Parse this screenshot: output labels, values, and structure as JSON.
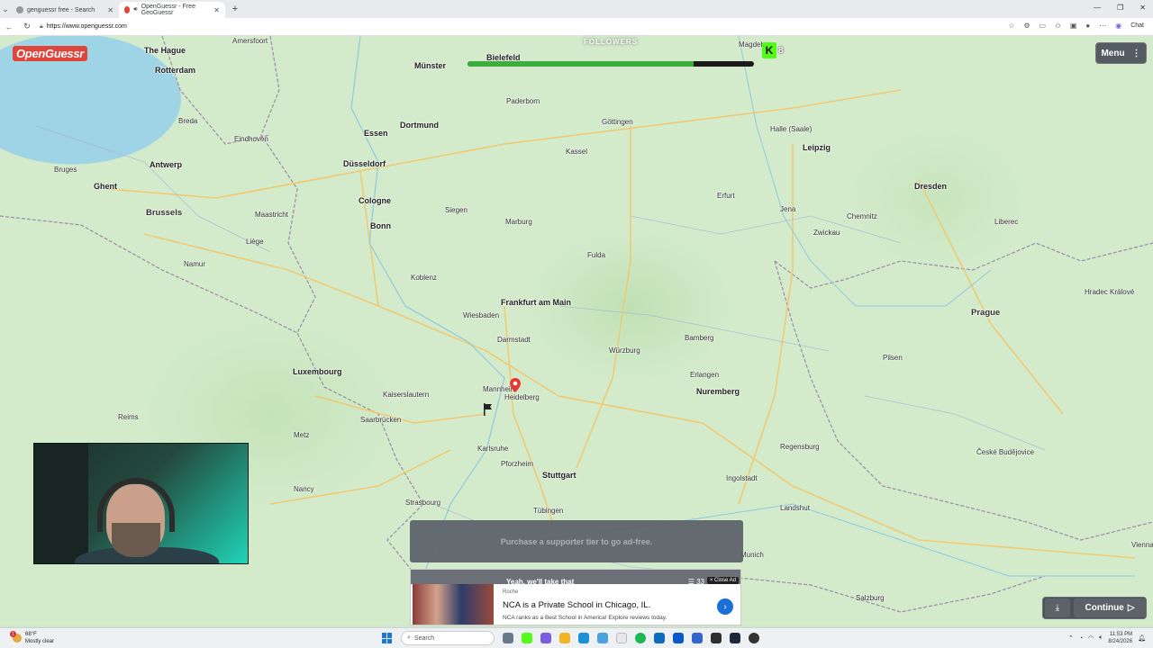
{
  "browser": {
    "tabs": [
      {
        "label": "genguessr free - Search",
        "active": false
      },
      {
        "label": "OpenGuessr - Free GeoGuessr",
        "active": true
      }
    ],
    "new_tab": "+",
    "url": "https://www.openguessr.com",
    "chat_label": "Chat",
    "window_controls": [
      "—",
      "❐",
      "✕"
    ]
  },
  "game": {
    "logo": "OpenGuessr",
    "menu_label": "Menu",
    "followers_label": "FOLLOWERS",
    "followers_progress": 0.79,
    "kick_count": "8",
    "continue_label": "Continue",
    "adfree_text": "Purchase a supporter tier to go ad-free."
  },
  "ad": {
    "header_text": "Yeah, we'll take that",
    "count": "33",
    "close_label": "× Close Ad",
    "sponsor": "Roche",
    "title": "NCA is a Private School in Chicago, IL.",
    "description": "NCA ranks as a Best School in America! Explore reviews today."
  },
  "map": {
    "cities": [
      {
        "name": "The Hague",
        "cls": "big"
      },
      {
        "name": "Rotterdam",
        "cls": "big"
      },
      {
        "name": "Amersfoort",
        "cls": ""
      },
      {
        "name": "Münster",
        "cls": "big"
      },
      {
        "name": "Bielefeld",
        "cls": "big"
      },
      {
        "name": "Magdeburg",
        "cls": ""
      },
      {
        "name": "Dortmund",
        "cls": "big"
      },
      {
        "name": "Essen",
        "cls": "big"
      },
      {
        "name": "Düsseldorf",
        "cls": "big"
      },
      {
        "name": "Antwerp",
        "cls": "big"
      },
      {
        "name": "Ghent",
        "cls": "big"
      },
      {
        "name": "Brussels",
        "cls": "cap"
      },
      {
        "name": "Cologne",
        "cls": "big"
      },
      {
        "name": "Bonn",
        "cls": "big"
      },
      {
        "name": "Leipzig",
        "cls": "big"
      },
      {
        "name": "Dresden",
        "cls": "big"
      },
      {
        "name": "Frankfurt am Main",
        "cls": "big"
      },
      {
        "name": "Prague",
        "cls": "cap"
      },
      {
        "name": "Luxembourg",
        "cls": "big"
      },
      {
        "name": "Nuremberg",
        "cls": "big"
      },
      {
        "name": "Stuttgart",
        "cls": "big"
      },
      {
        "name": "Heidelberg",
        "cls": ""
      },
      {
        "name": "Hradec Králové",
        "cls": ""
      },
      {
        "name": "Vienna",
        "cls": ""
      },
      {
        "name": "Munich",
        "cls": ""
      },
      {
        "name": "Eindhoven",
        "cls": ""
      },
      {
        "name": "Maastricht",
        "cls": ""
      },
      {
        "name": "Göttingen",
        "cls": ""
      },
      {
        "name": "Kassel",
        "cls": ""
      },
      {
        "name": "Halle (Saale)",
        "cls": ""
      },
      {
        "name": "Erfurt",
        "cls": ""
      },
      {
        "name": "Jena",
        "cls": ""
      },
      {
        "name": "Chemnitz",
        "cls": ""
      },
      {
        "name": "Würzburg",
        "cls": ""
      },
      {
        "name": "Erlangen",
        "cls": ""
      },
      {
        "name": "Regensburg",
        "cls": ""
      },
      {
        "name": "Ingolstadt",
        "cls": ""
      },
      {
        "name": "Karlsruhe",
        "cls": ""
      },
      {
        "name": "Strasbourg",
        "cls": ""
      },
      {
        "name": "Metz",
        "cls": ""
      },
      {
        "name": "Saarbrücken",
        "cls": ""
      },
      {
        "name": "Kaiserslautern",
        "cls": ""
      },
      {
        "name": "Mannheim",
        "cls": ""
      },
      {
        "name": "Wiesbaden",
        "cls": ""
      },
      {
        "name": "Darmstadt",
        "cls": ""
      },
      {
        "name": "Pilsen",
        "cls": ""
      },
      {
        "name": "České Budějovice",
        "cls": ""
      },
      {
        "name": "Salzburg",
        "cls": ""
      },
      {
        "name": "Liège",
        "cls": ""
      },
      {
        "name": "Namur",
        "cls": ""
      },
      {
        "name": "Reims",
        "cls": ""
      },
      {
        "name": "Nancy",
        "cls": ""
      },
      {
        "name": "Bruges",
        "cls": ""
      },
      {
        "name": "Breda",
        "cls": ""
      },
      {
        "name": "Koblenz",
        "cls": ""
      },
      {
        "name": "Siegen",
        "cls": ""
      },
      {
        "name": "Paderborn",
        "cls": ""
      },
      {
        "name": "Marburg",
        "cls": ""
      },
      {
        "name": "Fulda",
        "cls": ""
      },
      {
        "name": "Bamberg",
        "cls": ""
      },
      {
        "name": "Pforzheim",
        "cls": ""
      },
      {
        "name": "Tübingen",
        "cls": ""
      },
      {
        "name": "Landshut",
        "cls": ""
      },
      {
        "name": "Zwickau",
        "cls": ""
      },
      {
        "name": "Liberec",
        "cls": ""
      }
    ]
  },
  "taskbar": {
    "weather_temp": "68°F",
    "weather_desc": "Mostly clear",
    "weather_badge": "1",
    "search_label": "Search",
    "time": "11:53 PM",
    "date": "8/24/2026"
  }
}
